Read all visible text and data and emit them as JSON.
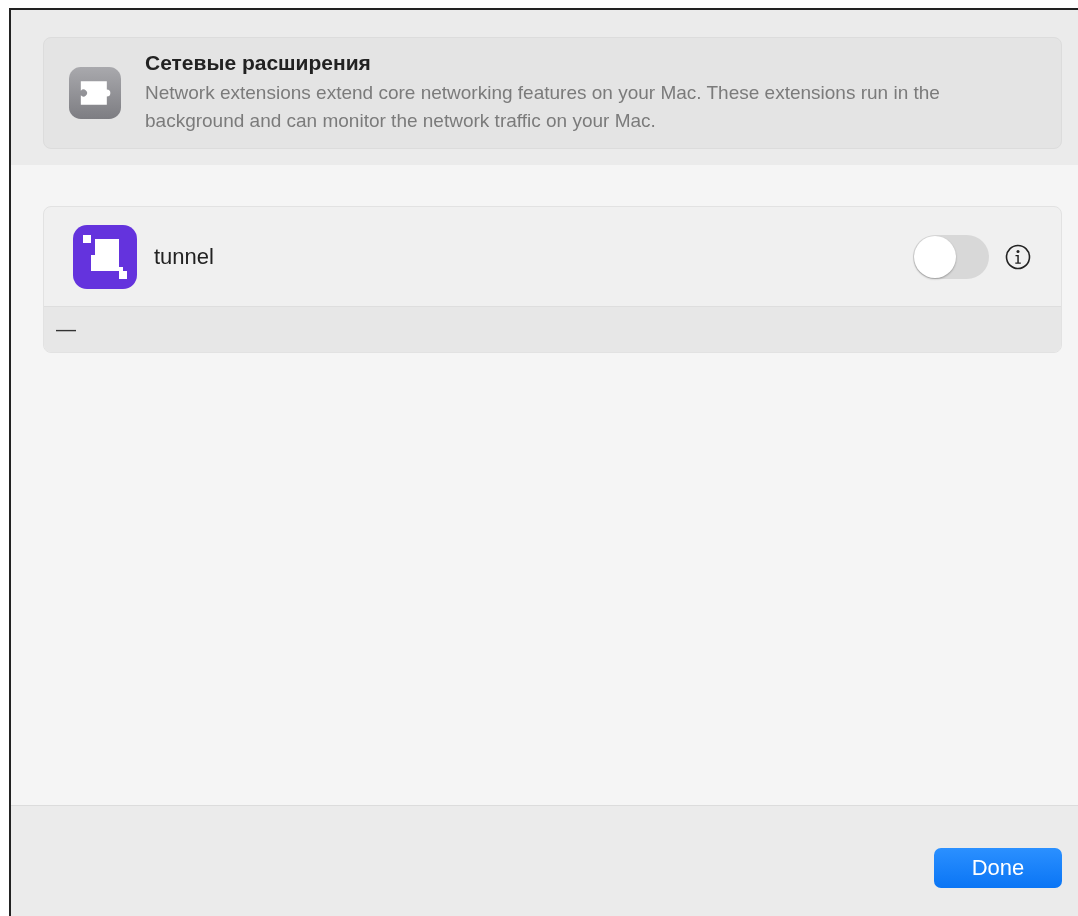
{
  "header": {
    "title": "Сетевые расширения",
    "description": "Network extensions extend core networking features on your Mac. These extensions run in the background and can monitor the network traffic on your Mac."
  },
  "extensions": [
    {
      "name": "tunnel",
      "on": false,
      "detail": "—"
    }
  ],
  "buttons": [
    {
      "label": "Done",
      "kind": "primary"
    }
  ]
}
